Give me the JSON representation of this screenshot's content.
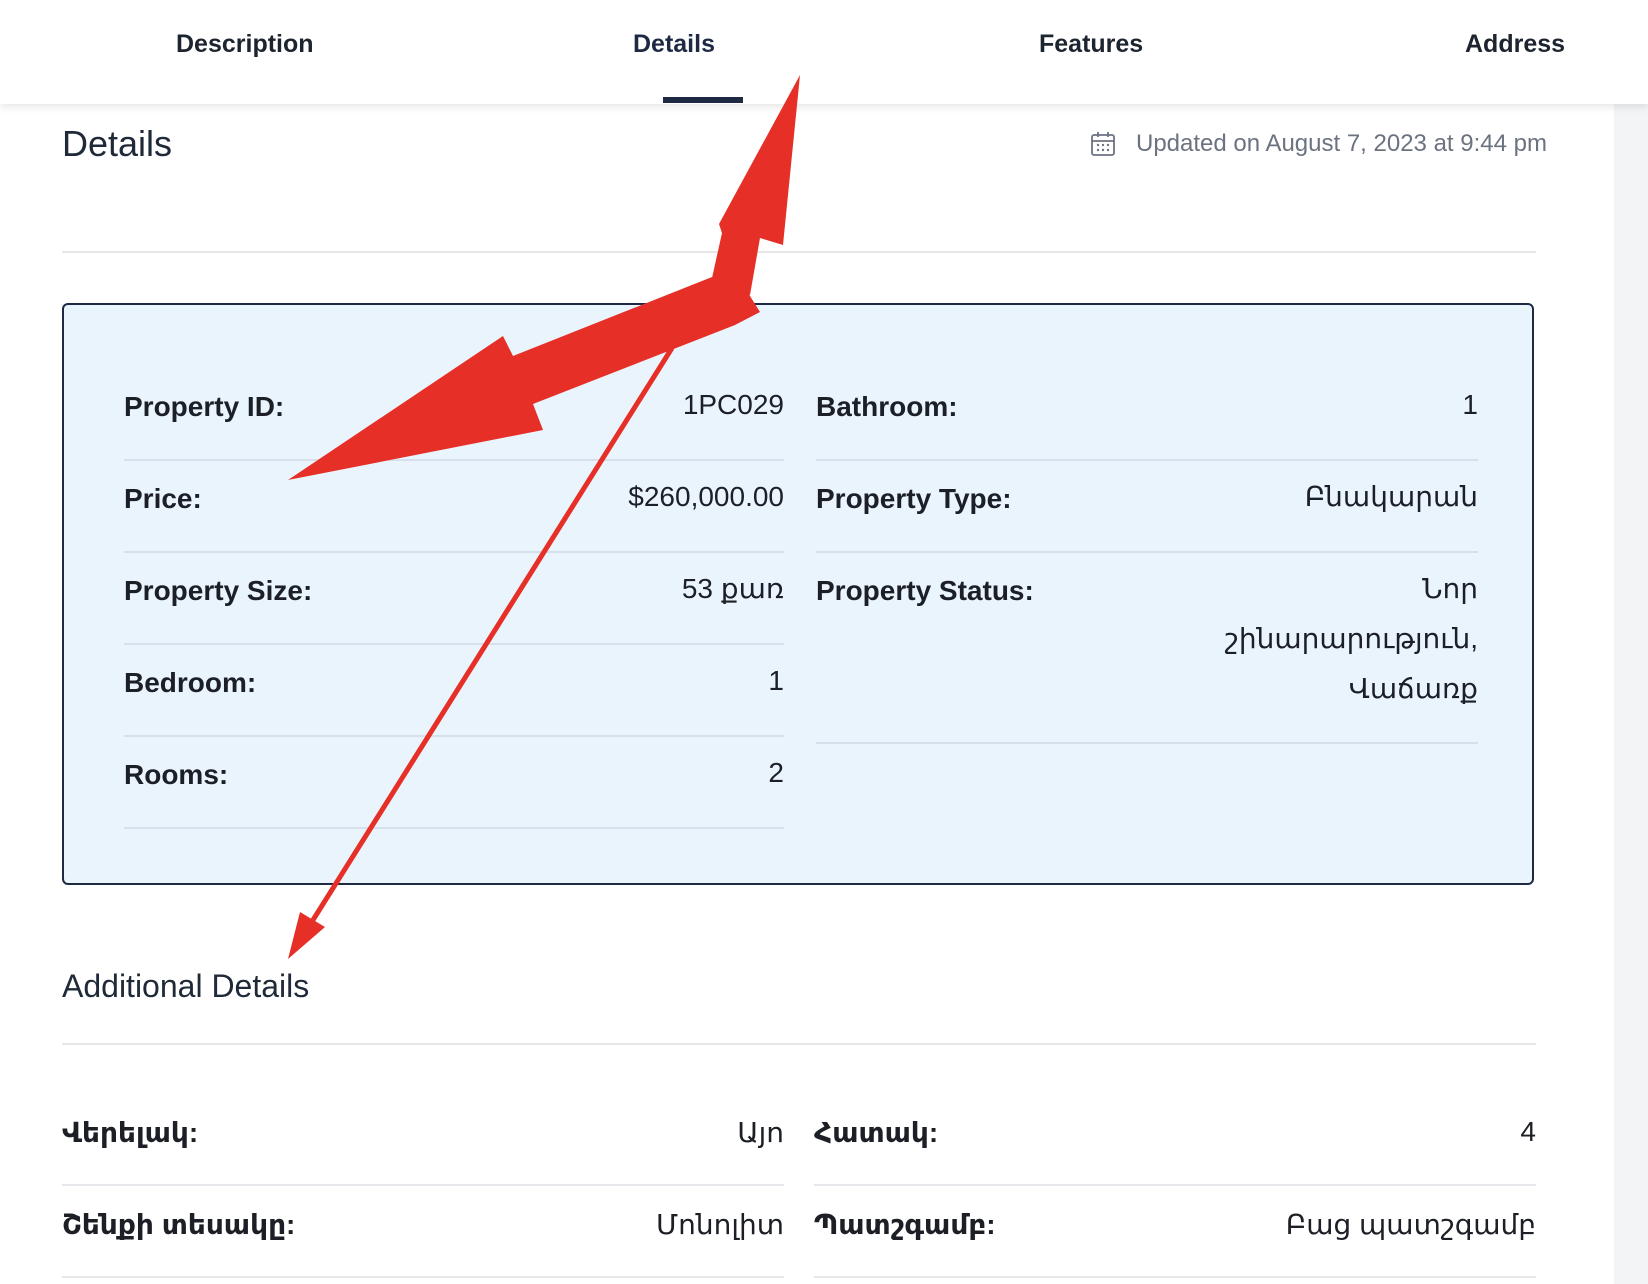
{
  "tabs": [
    {
      "label": "Description"
    },
    {
      "label": "Details",
      "active": true
    },
    {
      "label": "Features"
    },
    {
      "label": "Address"
    }
  ],
  "section": {
    "title": "Details",
    "updated": "Updated on August 7, 2023 at 9:44 pm",
    "updated_icon": "calendar-icon"
  },
  "details": {
    "left": [
      {
        "label": "Property ID:",
        "value": "1PC029"
      },
      {
        "label": "Price:",
        "value": "$260,000.00"
      },
      {
        "label": "Property Size:",
        "value": "53 քառ"
      },
      {
        "label": "Bedroom:",
        "value": "1"
      },
      {
        "label": "Rooms:",
        "value": "2"
      }
    ],
    "right": [
      {
        "label": "Bathroom:",
        "value": "1"
      },
      {
        "label": "Property Type:",
        "value": "Բնակարան"
      },
      {
        "label": "Property Status:",
        "value_lines": [
          "Նոր",
          "շինարարություն,",
          "Վաճառք"
        ]
      }
    ]
  },
  "additional": {
    "title": "Additional Details",
    "rows": [
      {
        "left": {
          "label": "Վերելակ:",
          "value": "Այո"
        },
        "right": {
          "label": "Հատակ:",
          "value": "4"
        }
      },
      {
        "left": {
          "label": "Շենքի տեսակը:",
          "value": "Մոնոլիտ"
        },
        "right": {
          "label": "Պատշգամբ:",
          "value": "Բաց պատշգամբ"
        }
      }
    ]
  },
  "colors": {
    "accent": "#1e2a44",
    "box_bg": "#eaf4fd",
    "annotation": "#e63027"
  }
}
